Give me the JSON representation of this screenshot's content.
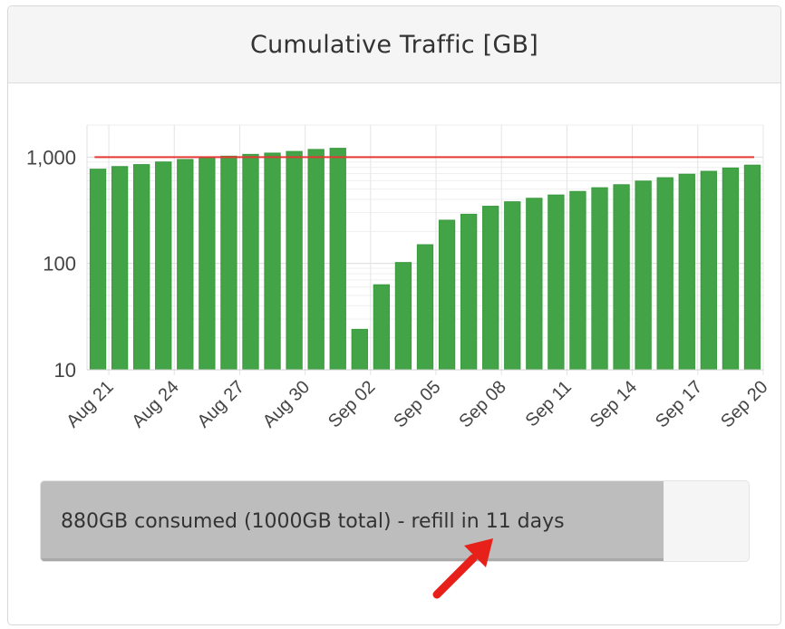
{
  "panel": {
    "title": "Cumulative Traffic [GB]"
  },
  "colors": {
    "bar": "#43a347",
    "bar_edge": "#3a9a3e",
    "limit_line": "#e53935",
    "progress_fill": "#bdbdbd",
    "annotation_arrow": "#e8201a"
  },
  "chart_data": {
    "type": "bar",
    "categories": [
      "Aug 21",
      "Aug 22",
      "Aug 23",
      "Aug 24",
      "Aug 25",
      "Aug 26",
      "Aug 27",
      "Aug 28",
      "Aug 29",
      "Aug 30",
      "Aug 31",
      "Sep 01",
      "Sep 02",
      "Sep 03",
      "Sep 04",
      "Sep 05",
      "Sep 06",
      "Sep 07",
      "Sep 08",
      "Sep 09",
      "Sep 10",
      "Sep 11",
      "Sep 12",
      "Sep 13",
      "Sep 14",
      "Sep 15",
      "Sep 16",
      "Sep 17",
      "Sep 18",
      "Sep 19",
      "Sep 20"
    ],
    "values": [
      770,
      815,
      850,
      900,
      950,
      990,
      1020,
      1060,
      1090,
      1130,
      1180,
      1210,
      24,
      63,
      102,
      150,
      255,
      290,
      345,
      380,
      410,
      440,
      475,
      515,
      550,
      595,
      640,
      690,
      735,
      790,
      840
    ],
    "tick_labels": [
      "Aug 21",
      "Aug 24",
      "Aug 27",
      "Aug 30",
      "Sep 02",
      "Sep 05",
      "Sep 08",
      "Sep 11",
      "Sep 14",
      "Sep 17",
      "Sep 20"
    ],
    "yscale": "log",
    "ylim": [
      10,
      2000
    ],
    "yticks": [
      10,
      100,
      1000
    ],
    "ytick_labels": [
      "10",
      "100",
      "1,000"
    ],
    "reference_line": 1000,
    "grid": true,
    "title": "",
    "xlabel": "",
    "ylabel": ""
  },
  "progress": {
    "text": "880GB consumed (1000GB total) - refill in 11 days",
    "fraction": 0.88
  },
  "annotation": {
    "icon": "red-arrow-icon"
  }
}
